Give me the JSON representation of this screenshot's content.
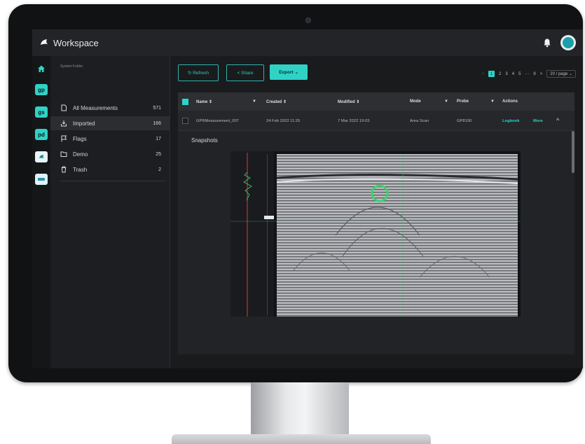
{
  "app": {
    "title": "Workspace"
  },
  "rail": {
    "items": [
      "gp",
      "gs",
      "pd",
      "",
      ""
    ]
  },
  "sidebar": {
    "section_label": "System Folder",
    "items": [
      {
        "label": "All Measurements",
        "count": "571",
        "icon": "document-icon"
      },
      {
        "label": "Imported",
        "count": "166",
        "icon": "import-icon"
      },
      {
        "label": "Flags",
        "count": "17",
        "icon": "flag-icon"
      },
      {
        "label": "Demo",
        "count": "25",
        "icon": "folder-icon"
      },
      {
        "label": "Trash",
        "count": "2",
        "icon": "trash-icon"
      }
    ]
  },
  "toolbar": {
    "refresh": "↻ Refresh",
    "share": "< Share",
    "export": "Export ⌄"
  },
  "pagination": {
    "pages": [
      "1",
      "2",
      "3",
      "4",
      "5",
      "···",
      "9"
    ],
    "current": "1",
    "page_size": "20 / page ⌄",
    "next": ">",
    "prev": "<"
  },
  "table": {
    "columns": [
      "Name ⇕",
      "Created ⇕",
      "Modified ⇕",
      "Mode",
      "Probe",
      "Actions"
    ],
    "rows": [
      {
        "name": "GPRMeasurement_007",
        "created": "24 Feb 2022 11:25",
        "modified": "7 Mar 2022 19:03",
        "mode": "Area Scan",
        "probe": "GP8100",
        "action_logbook": "Logbook",
        "action_more": "More",
        "expand": "^"
      }
    ]
  },
  "snapshots": {
    "title": "Snapshots"
  },
  "colors": {
    "accent": "#2ed3c6",
    "background": "#1a1b1d",
    "highlight_circle": "#3bd36b"
  }
}
